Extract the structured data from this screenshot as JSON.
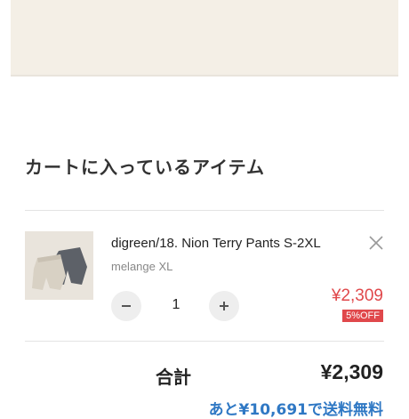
{
  "cart": {
    "title": "カートに入っているアイテム",
    "items": [
      {
        "name": "digreen/18. Nion Terry Pants S-2XL",
        "variant": "melange XL",
        "quantity": "1",
        "price": "¥2,309",
        "discount_badge": "5%OFF"
      }
    ]
  },
  "summary": {
    "total_label": "合計",
    "total_amount": "¥2,309",
    "shipping_note": "あと¥10,691で送料無料"
  },
  "icons": {
    "remove": "close-icon",
    "decrease": "minus-icon",
    "increase": "plus-icon"
  },
  "colors": {
    "price": "#e0484b",
    "link": "#2f78c4",
    "banner": "#f4efe6"
  }
}
